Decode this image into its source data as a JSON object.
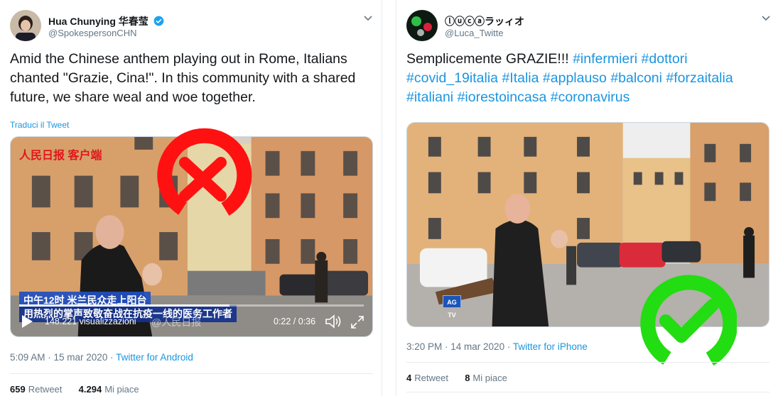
{
  "left_tweet": {
    "name": "Hua Chunying 华春莹",
    "handle": "@SpokespersonCHN",
    "text": "Amid the Chinese anthem playing out in Rome, Italians chanted \"Grazie, Cina!\". In this community with a shared future, we share weal and woe together.",
    "translate_label": "Traduci il Tweet",
    "video": {
      "logo": "人民日报 客户端",
      "caption_line1": "中午12时 米兰民众走上阳台",
      "caption_line2": "用热烈的掌声致敬奋战在抗疫一线的医务工作者",
      "views": "148.221 visualizzazioni",
      "watermark": "@人民日报",
      "time": "0:22 / 0:36",
      "progress": 0.61
    },
    "timestamp": "5:09 AM · 15 mar 2020",
    "source": "Twitter for Android",
    "retweets_count": "659",
    "retweets_label": "Retweet",
    "likes_count": "4.294",
    "likes_label": "Mi piace",
    "verdict_icon": "red-cross-icon",
    "verdict_color": "#ff1111"
  },
  "right_tweet": {
    "name": "ⓛⓤⓒⓐラッィオ",
    "handle": "@Luca_Twitte",
    "text_plain": "Semplicemente GRAZIE!!! ",
    "hashtags": [
      "#infermieri",
      "#dottori",
      "#covid_19italia",
      "#Italia",
      "#applauso",
      "#balconi",
      "#forzaitalia",
      "#italiani",
      "#iorestoincasa",
      "#coronavirus"
    ],
    "video_logo": "AG TV",
    "timestamp": "3:20 PM · 14 mar 2020",
    "source": "Twitter for iPhone",
    "retweets_count": "4",
    "retweets_label": "Retweet",
    "likes_count": "8",
    "likes_label": "Mi piace",
    "verdict_icon": "green-check-icon",
    "verdict_color": "#22dd11"
  },
  "colors": {
    "link": "#1b95e0",
    "muted": "#657786",
    "text": "#14171a",
    "verified": "#1da1f2"
  }
}
